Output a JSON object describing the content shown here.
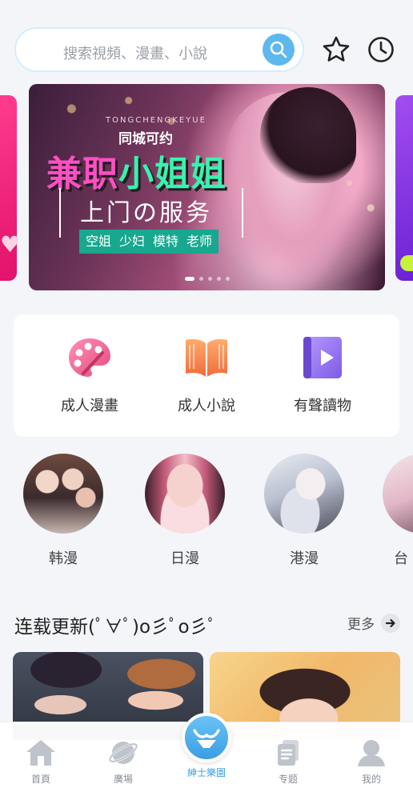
{
  "search": {
    "placeholder": "搜索視頻、漫畫、小說"
  },
  "header_icons": [
    "star-icon",
    "clock-icon",
    "search-icon"
  ],
  "banner": {
    "subtitle": "TONGCHENGKEYUE",
    "brand": "同城可约",
    "title_part1": "兼职",
    "title_part2": "小姐姐",
    "service": "上门の服务",
    "tags": [
      "空姐",
      "少妇",
      "模特",
      "老师"
    ]
  },
  "categories": [
    {
      "label": "成人漫畫",
      "icon": "palette-icon"
    },
    {
      "label": "成人小說",
      "icon": "book-icon"
    },
    {
      "label": "有聲讀物",
      "icon": "audio-play-icon"
    }
  ],
  "circles": [
    {
      "label": "韩漫"
    },
    {
      "label": "日漫"
    },
    {
      "label": "港漫"
    },
    {
      "label": "台"
    }
  ],
  "section": {
    "title": "连载更新(ﾟ∀ﾟ)o彡ﾟo彡ﾟ",
    "more": "更多"
  },
  "nav": [
    {
      "label": "首頁",
      "icon": "home-icon"
    },
    {
      "label": "廣場",
      "icon": "planet-icon"
    },
    {
      "label": "紳士樂園",
      "icon": "lingerie-icon",
      "active": true
    },
    {
      "label": "专题",
      "icon": "documents-icon"
    },
    {
      "label": "我的",
      "icon": "user-icon"
    }
  ],
  "colors": {
    "accent": "#3c9fe0",
    "search_button": "#5db8ee",
    "banner_tag_bg": "#17a88f",
    "page_bg": "#f4f5f9"
  }
}
